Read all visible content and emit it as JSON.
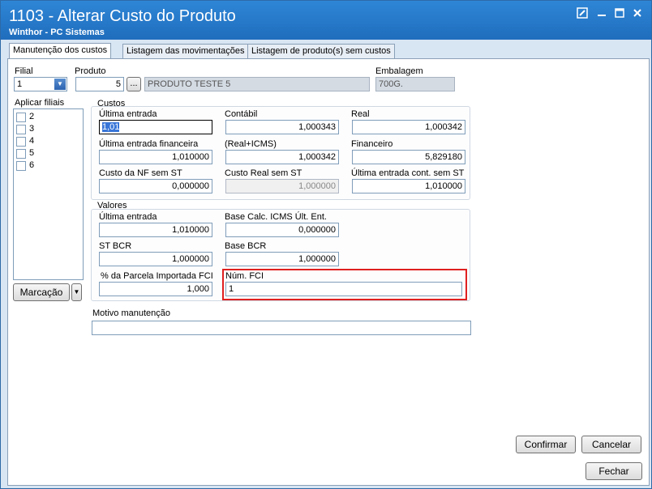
{
  "window": {
    "title": "1103 - Alterar Custo do Produto",
    "subtitle": "Winthor - PC Sistemas"
  },
  "tabs": [
    {
      "label": "Manutenção dos custos"
    },
    {
      "label": "Listagem das movimentações"
    },
    {
      "label": "Listagem de produto(s)  sem custos"
    }
  ],
  "top": {
    "filial_label": "Filial",
    "filial_value": "1",
    "produto_label": "Produto",
    "produto_code": "5",
    "produto_browse": "...",
    "produto_desc": "PRODUTO TESTE 5",
    "embalagem_label": "Embalagem",
    "embalagem_value": "700G."
  },
  "filiais": {
    "label": "Aplicar filiais",
    "items": [
      "2",
      "3",
      "4",
      "5",
      "6"
    ],
    "marcacao_label": "Marcação"
  },
  "custos": {
    "group_label": "Custos",
    "ultima_entrada_label": "Última entrada",
    "ultima_entrada_value": "1,01",
    "contabil_label": "Contábil",
    "contabil_value": "1,000343",
    "real_label": "Real",
    "real_value": "1,000342",
    "ultima_entrada_fin_label": "Última entrada financeira",
    "ultima_entrada_fin_value": "1,010000",
    "real_icms_label": "(Real+ICMS)",
    "real_icms_value": "1,000342",
    "financeiro_label": "Financeiro",
    "financeiro_value": "5,829180",
    "custo_nf_label": "Custo da NF sem ST",
    "custo_nf_value": "0,000000",
    "custo_real_label": "Custo Real sem ST",
    "custo_real_value": "1,000000",
    "ultima_cont_label": "Última entrada cont. sem ST",
    "ultima_cont_value": "1,010000"
  },
  "valores": {
    "group_label": "Valores",
    "ultima_entrada_label": "Última entrada",
    "ultima_entrada_value": "1,010000",
    "base_calc_label": "Base Calc. ICMS Últ. Ent.",
    "base_calc_value": "0,000000",
    "st_bcr_label": "ST BCR",
    "st_bcr_value": "1,000000",
    "base_bcr_label": "Base BCR",
    "base_bcr_value": "1,000000",
    "parcela_label": "% da Parcela Importada FCI",
    "parcela_value": "1,000",
    "num_fci_label": "Núm. FCI",
    "num_fci_value": "1"
  },
  "motivo": {
    "label": "Motivo manutenção",
    "value": ""
  },
  "buttons": {
    "confirmar": "Confirmar",
    "cancelar": "Cancelar",
    "fechar": "Fechar"
  },
  "colors": {
    "titlebar": "#1f6dbd",
    "highlight_box": "#e02020"
  }
}
